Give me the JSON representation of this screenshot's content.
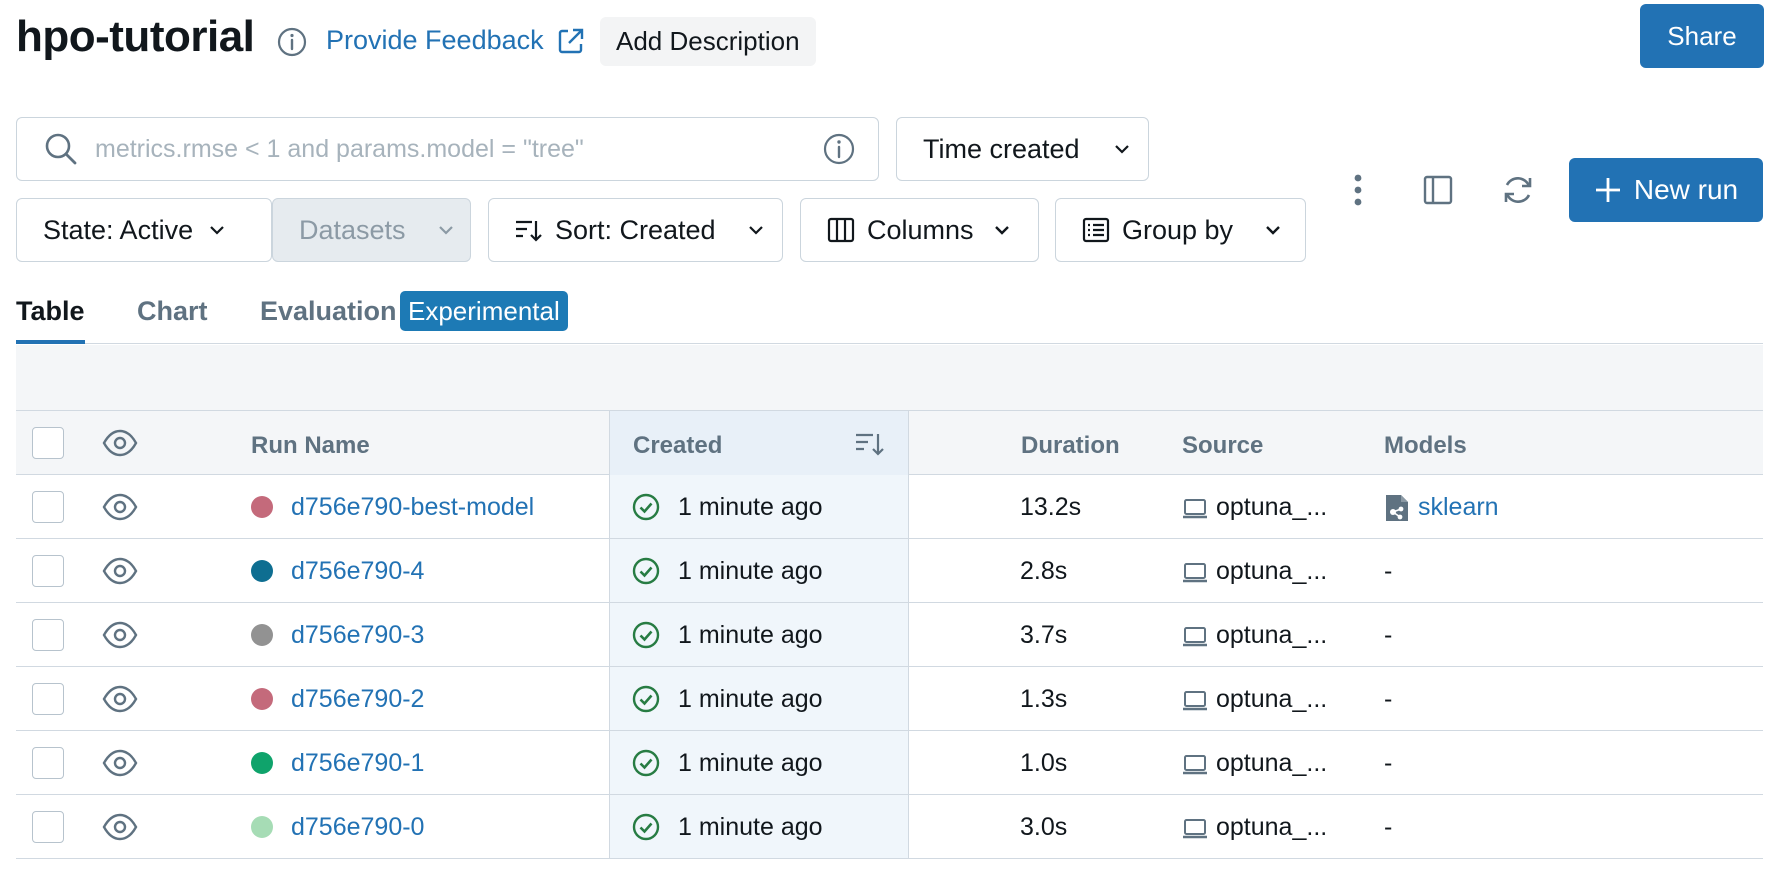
{
  "header": {
    "title": "hpo-tutorial",
    "feedback_label": "Provide Feedback",
    "add_description_label": "Add Description",
    "share_label": "Share"
  },
  "toolbar": {
    "search_placeholder": "metrics.rmse < 1 and params.model = \"tree\"",
    "time_created_label": "Time created",
    "state_label": "State: Active",
    "datasets_label": "Datasets",
    "sort_label": "Sort: Created",
    "columns_label": "Columns",
    "group_by_label": "Group by",
    "new_run_label": "New run"
  },
  "tabs": [
    {
      "label": "Table",
      "active": true
    },
    {
      "label": "Chart",
      "active": false
    },
    {
      "label": "Evaluation",
      "active": false
    }
  ],
  "evaluation_badge": "Experimental",
  "table": {
    "headers": {
      "run_name": "Run Name",
      "created": "Created",
      "duration": "Duration",
      "source": "Source",
      "models": "Models"
    },
    "rows": [
      {
        "run_name": "d756e790-best-model",
        "color": "#c46a7b",
        "created": "1 minute ago",
        "duration": "13.2s",
        "source": "optuna_...",
        "model": "sklearn"
      },
      {
        "run_name": "d756e790-4",
        "color": "#0e6e91",
        "created": "1 minute ago",
        "duration": "2.8s",
        "source": "optuna_...",
        "model": "-"
      },
      {
        "run_name": "d756e790-3",
        "color": "#929292",
        "created": "1 minute ago",
        "duration": "3.7s",
        "source": "optuna_...",
        "model": "-"
      },
      {
        "run_name": "d756e790-2",
        "color": "#c46a7b",
        "created": "1 minute ago",
        "duration": "1.3s",
        "source": "optuna_...",
        "model": "-"
      },
      {
        "run_name": "d756e790-1",
        "color": "#0fa36b",
        "created": "1 minute ago",
        "duration": "1.0s",
        "source": "optuna_...",
        "model": "-"
      },
      {
        "run_name": "d756e790-0",
        "color": "#a6dcb5",
        "created": "1 minute ago",
        "duration": "3.0s",
        "source": "optuna_...",
        "model": "-"
      }
    ]
  }
}
